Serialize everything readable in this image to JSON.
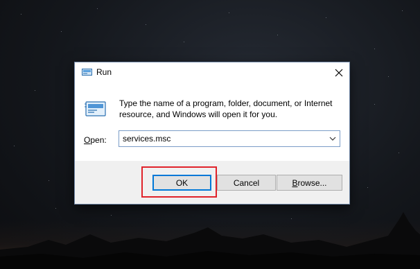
{
  "dialog": {
    "title": "Run",
    "description": "Type the name of a program, folder, document, or Internet resource, and Windows will open it for you.",
    "open_label_accel": "O",
    "open_label_rest": "pen:",
    "open_value": "services.msc",
    "buttons": {
      "ok": "OK",
      "cancel": "Cancel",
      "browse_accel": "B",
      "browse_rest": "rowse..."
    }
  },
  "icons": {
    "title": "run-icon",
    "body": "run-icon",
    "close": "close-icon",
    "dropdown": "chevron-down-icon"
  },
  "colors": {
    "highlight": "#e0222a",
    "accent": "#0078d7"
  }
}
